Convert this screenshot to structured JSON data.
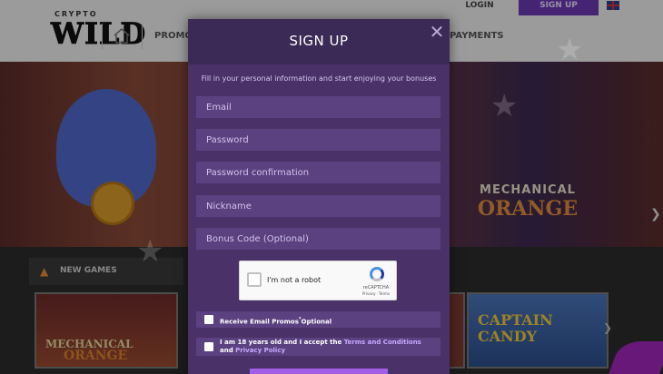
{
  "topbar": {
    "logo_small": "CRYPTO",
    "logo_big": "WILD",
    "login": "LOGIN",
    "signup": "SIGN UP",
    "nav": [
      "PROMO",
      "PAYMENTS"
    ]
  },
  "hero": {
    "badge_line1": "MECHANICAL",
    "badge_line2": "ORANGE"
  },
  "games": {
    "title": "NEW GAMES",
    "tile_left_line1": "MECHANICAL",
    "tile_left_line2": "ORANGE",
    "tile_right": "CAPTAIN CANDY"
  },
  "modal": {
    "title": "SIGN UP",
    "intro": "Fill in your personal information and start enjoying your bonuses",
    "fields": {
      "email": "Email",
      "password": "Password",
      "password_confirmation": "Password confirmation",
      "nickname": "Nickname",
      "bonus_code": "Bonus Code (Optional)"
    },
    "captcha": {
      "label": "I'm not a robot",
      "brand": "reCAPTCHA",
      "links": "Privacy · Terms"
    },
    "promos_label": "Receive Email Promos",
    "promos_suffix": "Optional",
    "terms_prefix": "I am 18 years old and I accept the ",
    "terms_link": "Terms and Conditions",
    "terms_and": " and ",
    "privacy_link": "Privacy Policy"
  },
  "colors": {
    "modal_bg": "#4a3268",
    "field_bg": "#5b4180",
    "accent": "#6a38b3"
  }
}
